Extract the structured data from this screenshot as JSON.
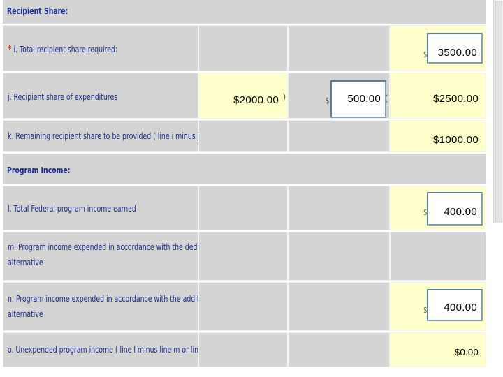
{
  "recipient_share": {
    "section_title": "Recipient Share:",
    "rows": [
      {
        "required_marker": "*",
        "label": "i. Total recipient share required:",
        "total": "3500.00"
      },
      {
        "label": "j. Recipient share of expenditures",
        "col2": "$2000.00",
        "col3": "500.00",
        "total": "$2500.00"
      },
      {
        "label": "k. Remaining recipient share to be provided ( line i minus j)",
        "total": "$1000.00"
      }
    ]
  },
  "program_income": {
    "section_title": "Program Income:",
    "rows": [
      {
        "label": "l. Total Federal program income earned",
        "total": "400.00"
      },
      {
        "label_line1": "m. Program income expended in accordance with the deduction",
        "label_line2": "alternative"
      },
      {
        "label_line1": "n. Program income expended in accordance with the addition",
        "label_line2": "alternative",
        "total": "400.00"
      },
      {
        "label": "o. Unexpended program income ( line l minus line m or line n)",
        "total": "$0.00"
      }
    ]
  },
  "currency_symbol": "$",
  "colors": {
    "gray_cell": "#d4d4d4",
    "yellow_cell": "#ffffcc",
    "label_text": "#1a2a8c",
    "input_border": "#7f9db9"
  }
}
